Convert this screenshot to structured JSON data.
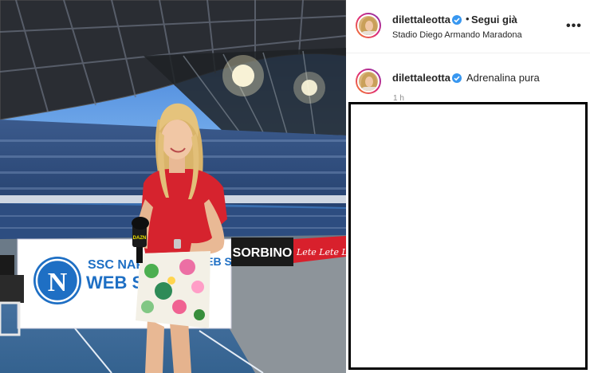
{
  "post": {
    "image_alt": "Reporter in red top and floral skirt holding a microphone at Stadio Diego Armando Maradona",
    "banner_texts": {
      "ssc_line1": "SSC NAPOLI",
      "ssc_line2": "WEB STORE",
      "web_store": "WEB STORE",
      "sorbino": "SORBINO",
      "red_banner": "Lete Lete Lete",
      "mic_label": "DAZN",
      "club_logo_letter": "N"
    }
  },
  "header": {
    "username": "dilettaleotta",
    "separator": "•",
    "follow_label": "Segui già",
    "location": "Stadio Diego Armando Maradona",
    "more_icon": "more-dots-icon"
  },
  "comment": {
    "username": "dilettaleotta",
    "caption": "Adrenalina pura",
    "timestamp": "1 h"
  },
  "colors": {
    "verified": "#3897f0",
    "red_top": "#d6232e",
    "napoli_blue": "#1e6fc4"
  }
}
